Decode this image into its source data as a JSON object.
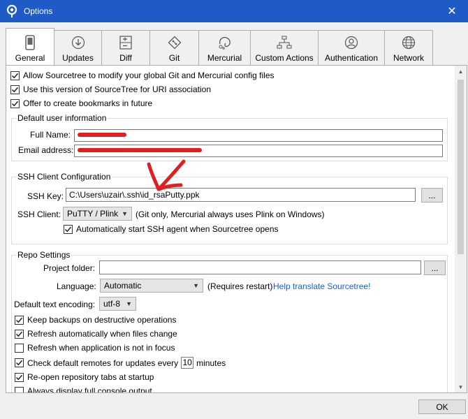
{
  "window": {
    "title": "Options",
    "close_glyph": "✕"
  },
  "tabs": [
    {
      "label": "General",
      "icon": "phone-icon",
      "active": true
    },
    {
      "label": "Updates",
      "icon": "download-icon"
    },
    {
      "label": "Diff",
      "icon": "diff-icon"
    },
    {
      "label": "Git",
      "icon": "git-icon"
    },
    {
      "label": "Mercurial",
      "icon": "mercurial-icon"
    },
    {
      "label": "Custom Actions",
      "icon": "workflow-icon"
    },
    {
      "label": "Authentication",
      "icon": "user-icon"
    },
    {
      "label": "Network",
      "icon": "globe-icon"
    }
  ],
  "general": {
    "allow_config": "Allow Sourcetree to modify your global Git and Mercurial config files",
    "uri_assoc": "Use this version of SourceTree for URI association",
    "bookmarks": "Offer to create bookmarks in future"
  },
  "user_info": {
    "legend": "Default user information",
    "full_name_label": "Full Name:",
    "email_label": "Email address:"
  },
  "ssh": {
    "legend": "SSH Client Configuration",
    "key_label": "SSH Key:",
    "key_value": "C:\\Users\\uzair\\.ssh\\id_rsaPutty.ppk",
    "browse_label": "...",
    "client_label": "SSH Client:",
    "client_value": "PuTTY / Plink",
    "client_note": "(Git only, Mercurial always uses Plink on Windows)",
    "auto_agent": "Automatically start SSH agent when Sourcetree opens"
  },
  "repo": {
    "legend": "Repo Settings",
    "project_folder_label": "Project folder:",
    "browse_label": "...",
    "language_label": "Language:",
    "language_value": "Automatic",
    "requires_restart": "(Requires restart)",
    "help_translate": "Help translate Sourcetree!",
    "encoding_label": "Default text encoding:",
    "encoding_value": "utf-8",
    "keep_backups": "Keep backups on destructive operations",
    "refresh_auto": "Refresh automatically when files change",
    "refresh_focus": "Refresh when application is not in focus",
    "check_remotes_prefix": "Check default remotes for updates every",
    "check_remotes_value": "10",
    "check_remotes_suffix": "minutes",
    "reopen_tabs": "Re-open repository tabs at startup",
    "console_output": "Always display full console output"
  },
  "footer": {
    "ok_label": "OK"
  },
  "colors": {
    "titlebar": "#1e5bc6",
    "link": "#1a62c6",
    "annotation": "#e02020"
  }
}
